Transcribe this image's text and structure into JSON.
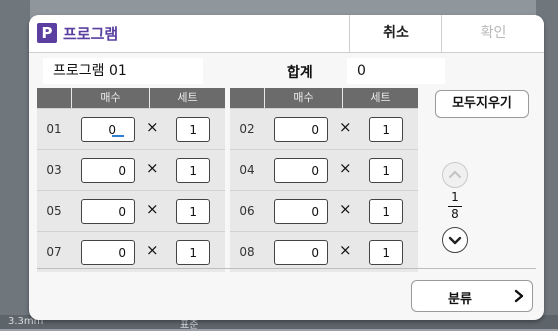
{
  "background": {
    "bottom_left": "3.3mm",
    "bottom_mid": "표준"
  },
  "dialog": {
    "title": "프로그램",
    "icon_letter": "P",
    "cancel": "취소",
    "ok": "확인"
  },
  "program": {
    "name": "프로그램 01",
    "total_label": "합계",
    "total_value": "0"
  },
  "table": {
    "headers": [
      "매수",
      "세트"
    ],
    "rows_left": [
      {
        "num": "01",
        "copies": "0",
        "sets": "1"
      },
      {
        "num": "03",
        "copies": "0",
        "sets": "1"
      },
      {
        "num": "05",
        "copies": "0",
        "sets": "1"
      },
      {
        "num": "07",
        "copies": "0",
        "sets": "1"
      }
    ],
    "rows_right": [
      {
        "num": "02",
        "copies": "0",
        "sets": "1"
      },
      {
        "num": "04",
        "copies": "0",
        "sets": "1"
      },
      {
        "num": "06",
        "copies": "0",
        "sets": "1"
      },
      {
        "num": "08",
        "copies": "0",
        "sets": "1"
      }
    ],
    "times_symbol": "×"
  },
  "controls": {
    "clear_all": "모두지우기",
    "page_current": "1",
    "page_total": "8",
    "sort": "분류"
  },
  "colors": {
    "accent": "#5a3fa0",
    "header_bg": "#6b6b6b",
    "focus_underline": "#2f7fd1"
  }
}
